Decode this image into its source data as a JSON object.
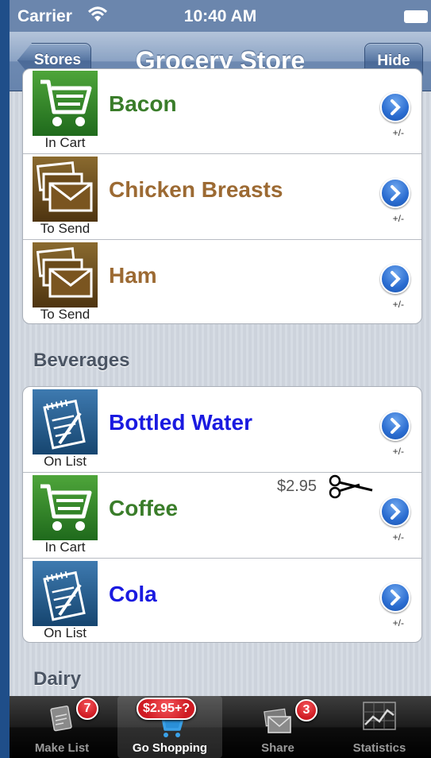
{
  "status_bar": {
    "carrier": "Carrier",
    "time": "10:40 AM"
  },
  "nav": {
    "back_label": "Stores",
    "title": "Grocery Store",
    "right_label": "Hide"
  },
  "groups": [
    {
      "header": "",
      "items": [
        {
          "name": "Bacon",
          "status": "In Cart",
          "icon": "cart-icon",
          "color": "#3a7d2a",
          "accessory": "+/-"
        },
        {
          "name": "Chicken Breasts",
          "status": "To Send",
          "icon": "envelopes-icon",
          "color": "#9c6a33",
          "accessory": "+/-"
        },
        {
          "name": "Ham",
          "status": "To Send",
          "icon": "envelopes-icon",
          "color": "#9c6a33",
          "accessory": "+/-"
        }
      ]
    },
    {
      "header": "Beverages",
      "items": [
        {
          "name": "Bottled Water",
          "status": "On List",
          "icon": "notepad-icon",
          "color": "#1a1ae0",
          "accessory": "+/-"
        },
        {
          "name": "Coffee",
          "status": "In Cart",
          "icon": "cart-icon",
          "color": "#3a7d2a",
          "accessory": "+/-",
          "price": "$2.95"
        },
        {
          "name": "Cola",
          "status": "On List",
          "icon": "notepad-icon",
          "color": "#1a1ae0",
          "accessory": "+/-"
        }
      ]
    }
  ],
  "next_header": "Dairy",
  "tabs": [
    {
      "label": "Make List",
      "badge": "7",
      "icon": "notepad-icon"
    },
    {
      "label": "Go Shopping",
      "badge": "$2.95+?",
      "icon": "cart-icon",
      "selected": true
    },
    {
      "label": "Share",
      "badge": "3",
      "icon": "envelopes-icon"
    },
    {
      "label": "Statistics",
      "badge": "",
      "icon": "chart-icon"
    }
  ]
}
